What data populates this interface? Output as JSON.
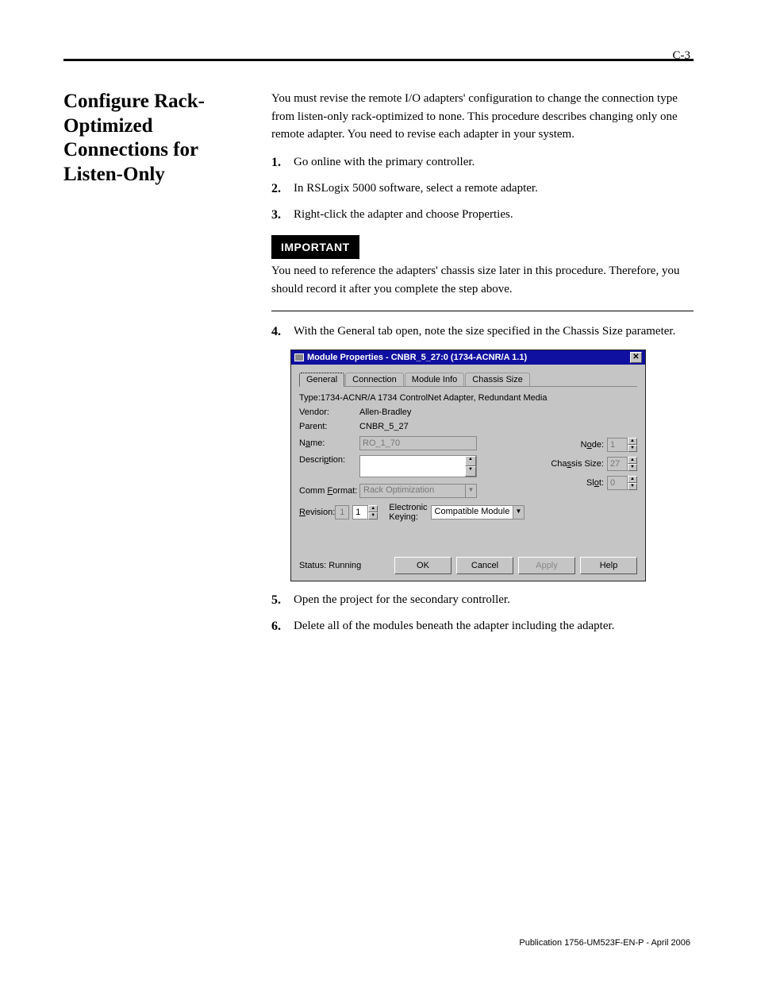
{
  "page_header_number": "C-3",
  "section_title": "Configure Rack-Optimized Connections for Listen-Only",
  "intro_para": "You must revise the remote I/O adapters' configuration to change the connection type from listen-only rack-optimized to none. This procedure describes changing only one remote adapter. You need to revise each adapter in your system.",
  "steps": [
    "Go online with the primary controller.",
    "In RSLogix 5000 software, select a remote adapter.",
    "Right-click the adapter and choose Properties.",
    "With the General tab open, note the size specified in the Chassis Size parameter."
  ],
  "important_label": "IMPORTANT",
  "important_text": "You need to reference the adapters' chassis size later in this procedure. Therefore, you should record it after you complete the step above.",
  "dialog": {
    "title": "Module Properties - CNBR_5_27:0 (1734-ACNR/A 1.1)",
    "tabs": [
      "General",
      "Connection",
      "Module Info",
      "Chassis Size"
    ],
    "type_label": "Type:",
    "type_value": "1734-ACNR/A 1734 ControlNet Adapter, Redundant Media",
    "vendor_label": "Vendor:",
    "vendor_value": "Allen-Bradley",
    "parent_label": "Parent:",
    "parent_value": "CNBR_5_27",
    "name_label": "Name:",
    "name_value": "RO_1_70",
    "description_label": "Description:",
    "commformat_label": "Comm Format:",
    "commformat_value": "Rack Optimization",
    "revision_label": "Revision:",
    "revision_major": "1",
    "revision_minor": "1",
    "node_label": "Node:",
    "node_value": "1",
    "chassis_label": "Chassis Size:",
    "chassis_value": "27",
    "slot_label": "Slot:",
    "slot_value": "0",
    "ekey_label": "Electronic Keying:",
    "ekey_value": "Compatible Module",
    "status": "Status: Running",
    "ok": "OK",
    "cancel": "Cancel",
    "apply": "Apply",
    "help": "Help"
  },
  "steps2": [
    "Open the project for the secondary controller.",
    "Delete all of the modules beneath the adapter including the adapter."
  ],
  "footer": "Publication 1756-UM523F-EN-P - April 2006"
}
